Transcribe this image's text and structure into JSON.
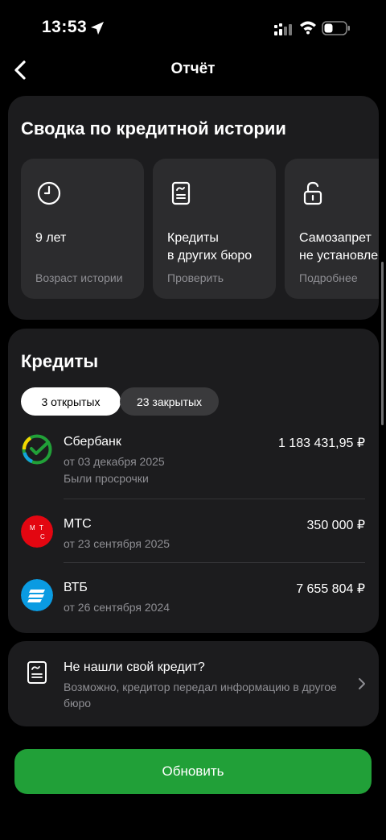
{
  "status": {
    "time": "13:53"
  },
  "nav": {
    "title": "Отчёт"
  },
  "summary": {
    "title": "Сводка по кредитной истории",
    "tiles": [
      {
        "title": "9 лет",
        "subtitle": "Возраст истории",
        "icon": "clock-icon"
      },
      {
        "title": "Кредиты\nв других бюро",
        "subtitle": "Проверить",
        "icon": "document-icon"
      },
      {
        "title": "Самозапрет\nне установлен",
        "subtitle": "Подробнее",
        "icon": "lock-open-icon"
      }
    ]
  },
  "credits": {
    "title": "Кредиты",
    "tabs": {
      "open": "3 открытых",
      "closed": "23 закрытых"
    },
    "loans": [
      {
        "bank": "Сбербанк",
        "amount": "1 183 431,95 ₽",
        "date": "от 03 декабря 2025",
        "note": "Были просрочки",
        "logo": "sber-logo-icon"
      },
      {
        "bank": "МТС",
        "amount": "350 000 ₽",
        "date": "от 23 сентября 2025",
        "note": "",
        "logo": "mts-logo-icon",
        "logo_text": "М Т С"
      },
      {
        "bank": "ВТБ",
        "amount": "7 655 804 ₽",
        "date": "от 26 сентября 2024",
        "note": "",
        "logo": "vtb-logo-icon"
      }
    ]
  },
  "not_found": {
    "title": "Не нашли свой кредит?",
    "description": "Возможно, кредитор передал информацию в другое бюро"
  },
  "refresh_label": "Обновить",
  "colors": {
    "accent": "#21a038",
    "card": "#1c1c1e",
    "tile": "#2c2c2e",
    "muted": "#8e8e93"
  }
}
